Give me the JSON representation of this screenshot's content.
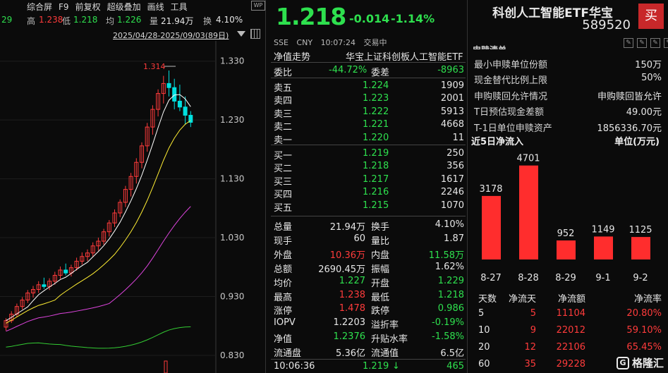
{
  "toolbar": {
    "items": [
      "综合屏",
      "F9",
      "前复权",
      "超级叠加",
      "画线",
      "工具"
    ],
    "icon": "wp-icon",
    "icon_text": "WP"
  },
  "quote_line": {
    "partial": "29",
    "high_label": "高",
    "high": "1.238",
    "low_label": "低",
    "low": "1.218",
    "avg_label": "均",
    "avg": "1.226",
    "vol_label": "量",
    "vol": "21.94万",
    "turn_label": "换",
    "turn": "4.10%"
  },
  "date_range": "2025/04/28-2025/09/03(89日)",
  "chart_data": {
    "type": "candlestick",
    "ylim": [
      0.8,
      1.35
    ],
    "y_ticks": [
      "1.330",
      "1.230",
      "1.130",
      "1.030",
      "0.930",
      "0.830"
    ],
    "max_label": "1.314",
    "note": "last ~35 of 89 daily candles visible; values estimated",
    "candles": [
      [
        0.878,
        0.893,
        0.872,
        0.889
      ],
      [
        0.889,
        0.905,
        0.885,
        0.9
      ],
      [
        0.9,
        0.918,
        0.895,
        0.913
      ],
      [
        0.913,
        0.929,
        0.908,
        0.924
      ],
      [
        0.924,
        0.941,
        0.919,
        0.936
      ],
      [
        0.936,
        0.948,
        0.928,
        0.942
      ],
      [
        0.942,
        0.956,
        0.936,
        0.95
      ],
      [
        0.95,
        0.962,
        0.943,
        0.947
      ],
      [
        0.947,
        0.961,
        0.941,
        0.956
      ],
      [
        0.956,
        0.972,
        0.95,
        0.966
      ],
      [
        0.966,
        0.981,
        0.96,
        0.975
      ],
      [
        0.975,
        0.986,
        0.966,
        0.97
      ],
      [
        0.97,
        0.984,
        0.964,
        0.979
      ],
      [
        0.979,
        0.996,
        0.974,
        0.99
      ],
      [
        0.99,
        1.005,
        0.984,
        0.998
      ],
      [
        0.998,
        1.01,
        0.99,
        1.004
      ],
      [
        1.004,
        1.022,
        0.998,
        1.016
      ],
      [
        1.016,
        1.03,
        1.008,
        1.024
      ],
      [
        1.024,
        1.045,
        1.018,
        1.04
      ],
      [
        1.04,
        1.06,
        1.032,
        1.055
      ],
      [
        1.055,
        1.078,
        1.048,
        1.072
      ],
      [
        1.072,
        1.095,
        1.065,
        1.09
      ],
      [
        1.09,
        1.118,
        1.082,
        1.112
      ],
      [
        1.112,
        1.14,
        1.1,
        1.134
      ],
      [
        1.134,
        1.165,
        1.122,
        1.158
      ],
      [
        1.158,
        1.192,
        1.148,
        1.186
      ],
      [
        1.186,
        1.225,
        1.176,
        1.218
      ],
      [
        1.218,
        1.255,
        1.205,
        1.248
      ],
      [
        1.248,
        1.282,
        1.236,
        1.275
      ],
      [
        1.275,
        1.305,
        1.258,
        1.292
      ],
      [
        1.292,
        1.314,
        1.27,
        1.285
      ],
      [
        1.285,
        1.3,
        1.248,
        1.262
      ],
      [
        1.262,
        1.29,
        1.245,
        1.252
      ],
      [
        1.252,
        1.27,
        1.222,
        1.238
      ],
      [
        1.238,
        1.245,
        1.218,
        1.226
      ]
    ]
  },
  "quote": {
    "price": "1.218",
    "change": "-0.014",
    "change_pct": "-1.14%",
    "name": "科创人工智能ETF华宝",
    "code": "589520",
    "buy_label": "买"
  },
  "status": {
    "exchange": "SSE",
    "currency": "CNY",
    "time": "10:07:24",
    "state": "交易中"
  },
  "nav_row": {
    "label": "净值走势",
    "desc": "华宝上证科创板人工智能ETF"
  },
  "weibi": {
    "label1": "委比",
    "val1": "-44.72%",
    "label2": "委差",
    "val2": "-8963"
  },
  "asks": [
    {
      "label": "卖五",
      "price": "1.224",
      "vol": "1909"
    },
    {
      "label": "卖四",
      "price": "1.223",
      "vol": "2001"
    },
    {
      "label": "卖三",
      "price": "1.222",
      "vol": "5913"
    },
    {
      "label": "卖二",
      "price": "1.221",
      "vol": "4668"
    },
    {
      "label": "卖一",
      "price": "1.220",
      "vol": "11"
    }
  ],
  "bids": [
    {
      "label": "买一",
      "price": "1.219",
      "vol": "250"
    },
    {
      "label": "买二",
      "price": "1.218",
      "vol": "356"
    },
    {
      "label": "买三",
      "price": "1.217",
      "vol": "1617"
    },
    {
      "label": "买四",
      "price": "1.216",
      "vol": "2246"
    },
    {
      "label": "买五",
      "price": "1.215",
      "vol": "1070"
    }
  ],
  "stats": [
    {
      "k1": "总量",
      "v1": "21.94万",
      "c1": "w",
      "k2": "换手",
      "v2": "4.10%",
      "c2": "w"
    },
    {
      "k1": "现手",
      "v1": "60",
      "c1": "w",
      "k2": "量比",
      "v2": "1.87",
      "c2": "w"
    },
    {
      "k1": "外盘",
      "v1": "10.36万",
      "c1": "r",
      "k2": "内盘",
      "v2": "11.58万",
      "c2": "g"
    },
    {
      "k1": "总额",
      "v1": "2690.45万",
      "c1": "w",
      "k2": "振幅",
      "v2": "1.62%",
      "c2": "w"
    },
    {
      "k1": "均价",
      "v1": "1.227",
      "c1": "g",
      "k2": "开盘",
      "v2": "1.229",
      "c2": "g"
    },
    {
      "k1": "最高",
      "v1": "1.238",
      "c1": "r",
      "k2": "最低",
      "v2": "1.218",
      "c2": "g"
    },
    {
      "k1": "涨停",
      "v1": "1.478",
      "c1": "r",
      "k2": "跌停",
      "v2": "0.986",
      "c2": "g"
    },
    {
      "k1": "IOPV",
      "v1": "1.2203",
      "c1": "w",
      "k2": "溢折率",
      "v2": "-0.19%",
      "c2": "g"
    },
    {
      "k1": "净值",
      "v1": "1.2376",
      "c1": "g",
      "k2": "升贴水率",
      "v2": "-1.58%",
      "c2": "g"
    },
    {
      "k1": "流通盘",
      "v1": "5.36亿",
      "c1": "w",
      "k2": "流通值",
      "v2": "6.5亿",
      "c2": "w"
    }
  ],
  "last_tick": {
    "time": "10:06:36",
    "price": "1.219",
    "arrow": "↓",
    "vol": "465"
  },
  "info_heading": "申赎清单",
  "info": [
    {
      "k": "最小申赎单位份额",
      "v": "150万"
    },
    {
      "k": "现金替代比例上限",
      "v": "50%"
    },
    {
      "k": "申购赎回允许情况",
      "v": "申购赎回皆允许"
    },
    {
      "k": "T日预估现金差额",
      "v": "49.00元"
    },
    {
      "k": "T-1日单位申赎资产",
      "v": "1856336.70元"
    }
  ],
  "flow": {
    "title": "近5日净流入",
    "unit": "单位(万元)",
    "bar_color": "#ff2d2d",
    "ylim": [
      0,
      5000
    ],
    "categories": [
      "8-27",
      "8-28",
      "8-29",
      "9-1",
      "9-2"
    ],
    "values": [
      3178,
      4701,
      952,
      1149,
      1125
    ]
  },
  "table": {
    "headers": [
      "天数",
      "净流天",
      "净流额",
      "净流率"
    ],
    "rows": [
      [
        "5",
        "5",
        "11104",
        "20.80%"
      ],
      [
        "10",
        "9",
        "22012",
        "59.10%"
      ],
      [
        "20",
        "12",
        "22106",
        "65.45%"
      ],
      [
        "60",
        "35",
        "29228",
        ""
      ]
    ]
  },
  "watermark": {
    "logo": "G",
    "text": "格隆汇"
  }
}
